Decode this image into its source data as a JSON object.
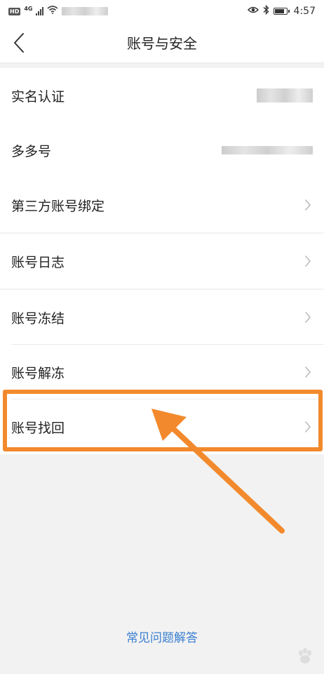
{
  "status_bar": {
    "hd": "HD",
    "network": "4G",
    "time": "4:57",
    "icons": [
      "signal-icon",
      "wifi-icon",
      "eye-icon",
      "bluetooth-icon",
      "battery-icon"
    ]
  },
  "header": {
    "title": "账号与安全",
    "back_icon": "chevron-left-icon"
  },
  "groups": [
    {
      "items": [
        {
          "label": "实名认证",
          "value": "",
          "chevron": false
        }
      ]
    },
    {
      "items": [
        {
          "label": "多多号",
          "value": "",
          "chevron": false
        }
      ]
    },
    {
      "items": [
        {
          "label": "第三方账号绑定",
          "chevron": true
        }
      ]
    },
    {
      "items": [
        {
          "label": "账号日志",
          "chevron": true
        }
      ]
    },
    {
      "items": [
        {
          "label": "账号冻结",
          "chevron": true
        },
        {
          "label": "账号解冻",
          "chevron": true
        },
        {
          "label": "账号找回",
          "chevron": true,
          "highlighted": true
        }
      ]
    }
  ],
  "footer": {
    "faq_link": "常见问题解答"
  },
  "colors": {
    "highlight": "#f28a2d",
    "link": "#3a7fd0",
    "background": "#f2f2f2"
  }
}
